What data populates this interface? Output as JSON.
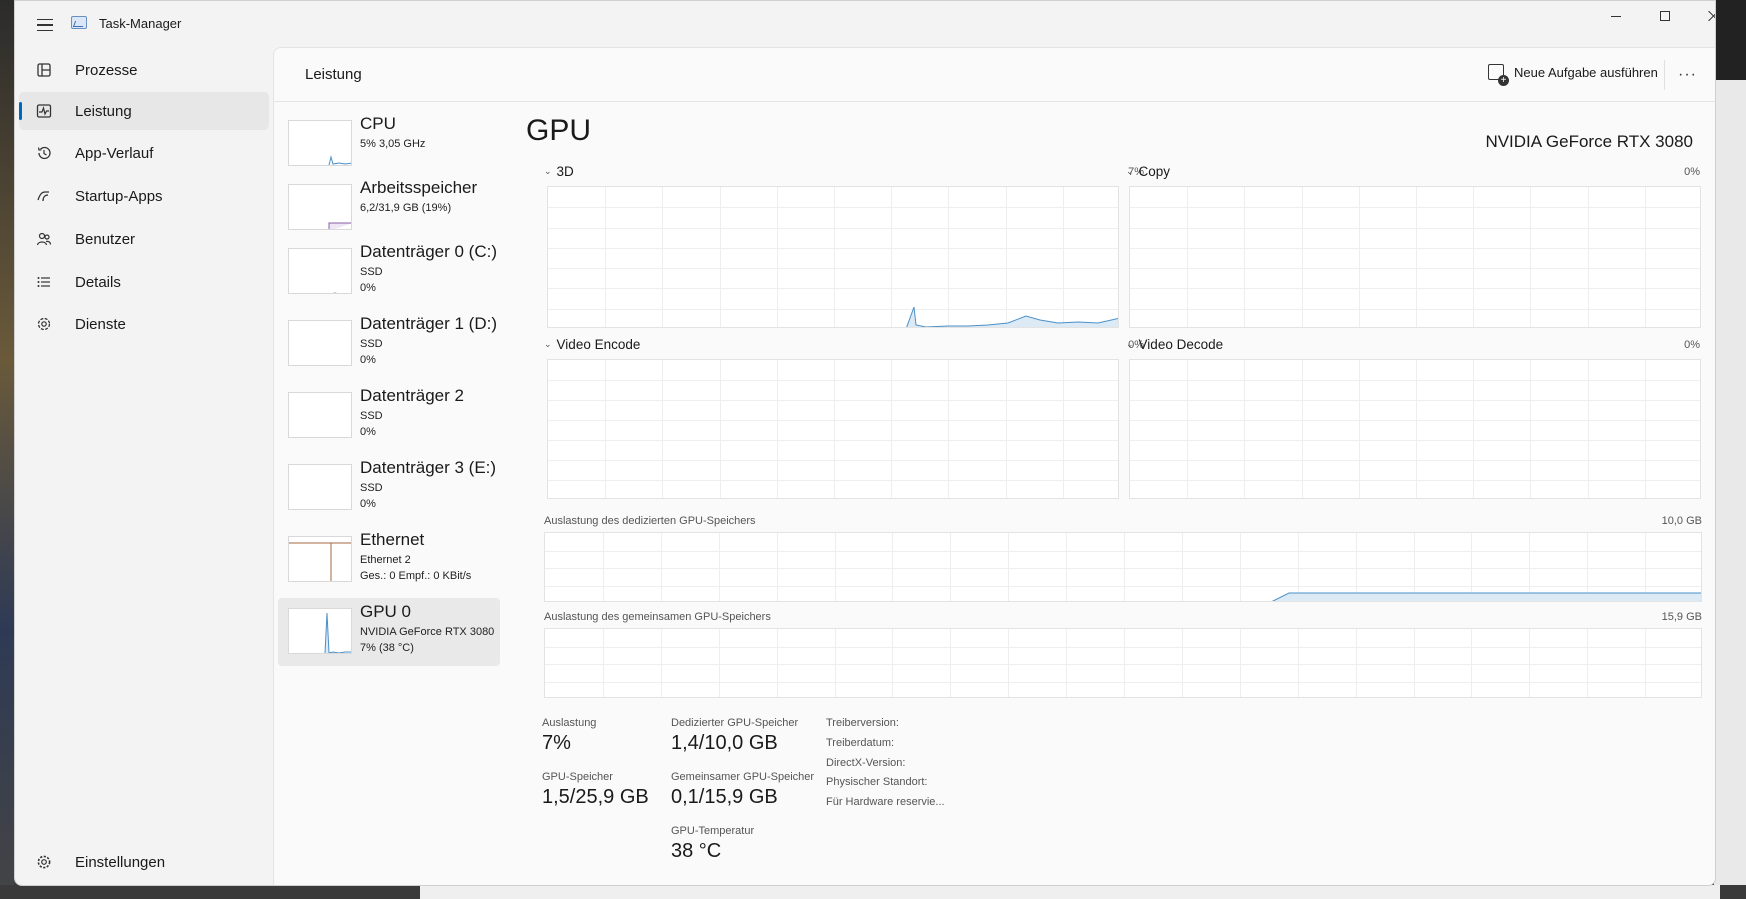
{
  "window": {
    "title": "Task-Manager"
  },
  "nav": {
    "items": [
      {
        "label": "Prozesse",
        "icon": "processes-icon"
      },
      {
        "label": "Leistung",
        "icon": "performance-icon"
      },
      {
        "label": "App-Verlauf",
        "icon": "history-icon"
      },
      {
        "label": "Startup-Apps",
        "icon": "startup-icon"
      },
      {
        "label": "Benutzer",
        "icon": "users-icon"
      },
      {
        "label": "Details",
        "icon": "details-icon"
      },
      {
        "label": "Dienste",
        "icon": "services-icon"
      }
    ],
    "settings_label": "Einstellungen",
    "active": "Leistung"
  },
  "header": {
    "page_title": "Leistung",
    "run_task_label": "Neue Aufgabe ausführen",
    "more_label": "···"
  },
  "devices": [
    {
      "name": "CPU",
      "line1": "5%  3,05 GHz",
      "line2": ""
    },
    {
      "name": "Arbeitsspeicher",
      "line1": "6,2/31,9 GB (19%)",
      "line2": ""
    },
    {
      "name": "Datenträger 0 (C:)",
      "line1": "SSD",
      "line2": "0%"
    },
    {
      "name": "Datenträger 1 (D:)",
      "line1": "SSD",
      "line2": "0%"
    },
    {
      "name": "Datenträger 2",
      "line1": "SSD",
      "line2": "0%"
    },
    {
      "name": "Datenträger 3 (E:)",
      "line1": "SSD",
      "line2": "0%"
    },
    {
      "name": "Ethernet",
      "line1": "Ethernet 2",
      "line2": "Ges.: 0  Empf.: 0 KBit/s"
    },
    {
      "name": "GPU 0",
      "line1": "NVIDIA GeForce RTX 3080",
      "line2": "7%  (38 °C)"
    }
  ],
  "gpu": {
    "title": "GPU",
    "model": "NVIDIA GeForce RTX 3080",
    "engines": [
      {
        "name": "3D",
        "percent": "7%"
      },
      {
        "name": "Copy",
        "percent": "0%"
      },
      {
        "name": "Video Encode",
        "percent": "0%"
      },
      {
        "name": "Video Decode",
        "percent": "0%"
      }
    ],
    "dedicated_mem_label": "Auslastung des dedizierten GPU-Speichers",
    "dedicated_mem_max": "10,0 GB",
    "shared_mem_label": "Auslastung des gemeinsamen GPU-Speichers",
    "shared_mem_max": "15,9 GB",
    "stats": {
      "utilization_label": "Auslastung",
      "utilization_value": "7%",
      "gpu_memory_label": "GPU-Speicher",
      "gpu_memory_value": "1,5/25,9 GB",
      "dedicated_label": "Dedizierter GPU-Speicher",
      "dedicated_value": "1,4/10,0 GB",
      "shared_label": "Gemeinsamer GPU-Speicher",
      "shared_value": "0,1/15,9 GB",
      "temp_label": "GPU-Temperatur",
      "temp_value": "38 °C"
    },
    "info": [
      "Treiberversion:",
      "Treiberdatum:",
      "DirectX-Version:",
      "Physischer Standort:",
      "Für Hardware reservie..."
    ]
  },
  "colors": {
    "accent": "#0067c0",
    "gpu_line": "#4a90c8",
    "gpu_fill": "#dceaf6",
    "memory_line": "#8a5fa8",
    "ethernet_line": "#a5673f"
  }
}
